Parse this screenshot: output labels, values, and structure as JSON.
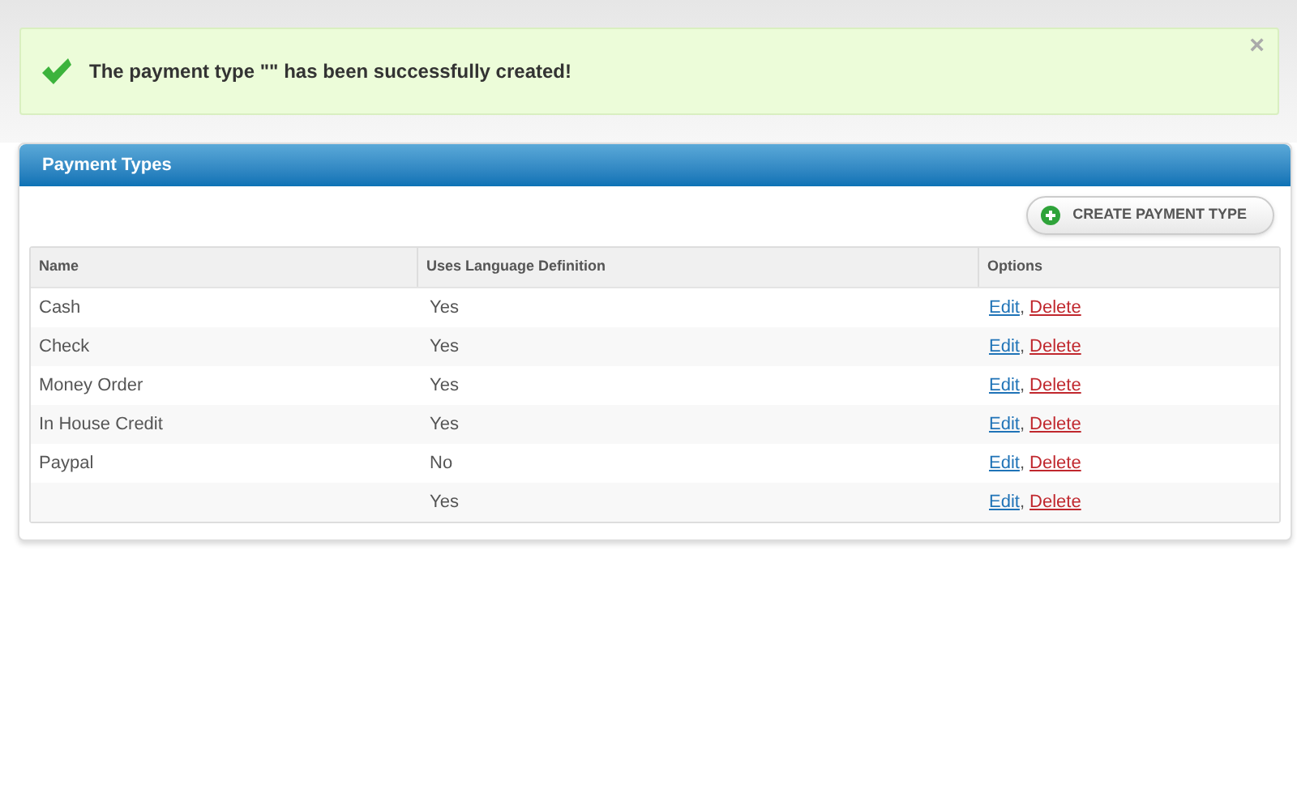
{
  "alert": {
    "message": "The payment type \"\" has been successfully created!",
    "close": "×"
  },
  "panel": {
    "title": "Payment Types",
    "create_button": "CREATE PAYMENT TYPE"
  },
  "table": {
    "columns": [
      "Name",
      "Uses Language Definition",
      "Options"
    ],
    "rows": [
      {
        "name": "Cash",
        "uses_language": "Yes",
        "edit": "Edit",
        "separator": ",",
        "delete": "Delete"
      },
      {
        "name": "Check",
        "uses_language": "Yes",
        "edit": "Edit",
        "separator": ",",
        "delete": "Delete"
      },
      {
        "name": "Money Order",
        "uses_language": "Yes",
        "edit": "Edit",
        "separator": ",",
        "delete": "Delete"
      },
      {
        "name": "In House Credit",
        "uses_language": "Yes",
        "edit": "Edit",
        "separator": ",",
        "delete": "Delete"
      },
      {
        "name": "Paypal",
        "uses_language": "No",
        "edit": "Edit",
        "separator": ",",
        "delete": "Delete"
      },
      {
        "uses_language": "Yes",
        "edit": "Edit",
        "separator": ",",
        "delete": "Delete"
      }
    ]
  }
}
